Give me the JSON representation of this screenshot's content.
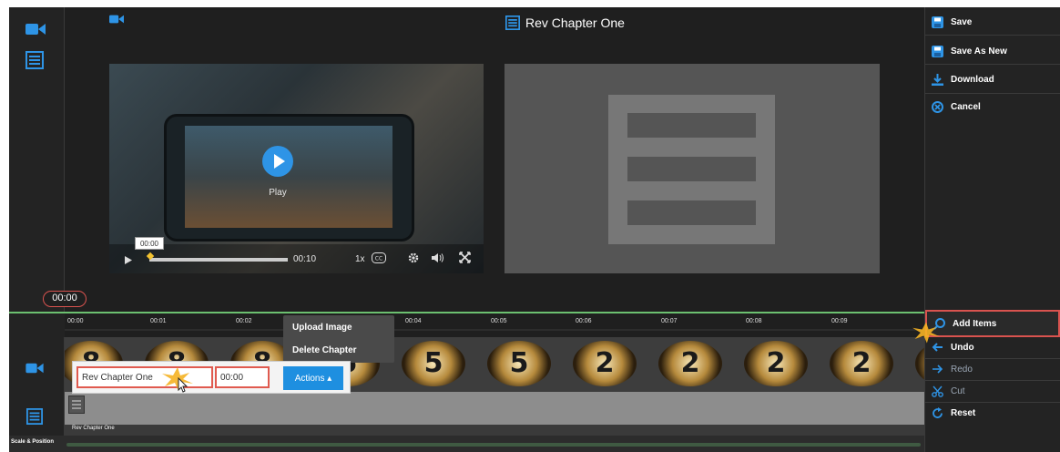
{
  "header": {
    "title": "Rev Chapter One"
  },
  "right_panel": {
    "save": "Save",
    "save_as_new": "Save As New",
    "download": "Download",
    "cancel": "Cancel",
    "add_items": "Add Items",
    "undo": "Undo",
    "redo": "Redo",
    "cut": "Cut",
    "reset": "Reset"
  },
  "video_player": {
    "play_label": "Play",
    "current_time_tooltip": "00:00",
    "duration": "00:10",
    "speed": "1x"
  },
  "playhead_time": "00:00",
  "timeline": {
    "ticks": [
      "00:00",
      "00:01",
      "00:02",
      "00:04",
      "00:05",
      "00:06",
      "00:07",
      "00:08",
      "00:09"
    ],
    "countdown_digits": [
      "8",
      "8",
      "8",
      "5",
      "5",
      "5",
      "2",
      "2",
      "2",
      "2",
      "2"
    ],
    "chapter_label": "Rev Chapter One",
    "scale_position_label": "Scale & Position"
  },
  "chapter_menu": {
    "upload_image": "Upload Image",
    "delete_chapter": "Delete Chapter"
  },
  "chapter_edit": {
    "name_value": "Rev Chapter One",
    "time_value": "00:00",
    "actions_label": "Actions ▴"
  },
  "colors": {
    "accent_blue": "#1e8fe0",
    "highlight_red": "#e05a4f",
    "panel_dark": "#1f1f1f",
    "timeline_green": "#6cc070"
  }
}
